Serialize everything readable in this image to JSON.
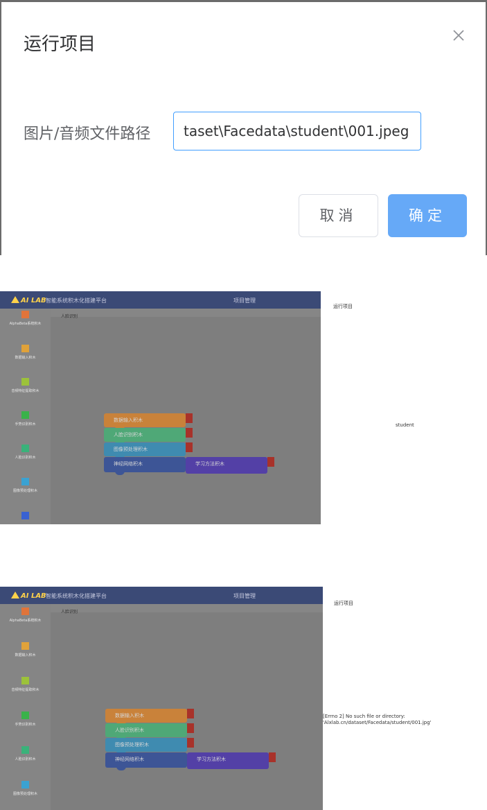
{
  "dialog": {
    "title": "运行项目",
    "close_icon": "close-icon",
    "field_label": "图片/音频文件路径",
    "path_value": "taset\\Facedata\\student\\001.jpeg",
    "cancel_label": "取消",
    "ok_label": "确定",
    "accent_color": "#409eff"
  },
  "app": {
    "brand": "AI LAB",
    "title": "智能系统积木化搭建平台",
    "menu_item": "项目管理",
    "tab": "人脸识别",
    "sidebar": [
      {
        "label": "AlphaBeta系统积木",
        "color": "#e0743a"
      },
      {
        "label": "数据输入积木",
        "color": "#e0a23a"
      },
      {
        "label": "音频特征提取积木",
        "color": "#9cc23a"
      },
      {
        "label": "手势识别积木",
        "color": "#3ab24a"
      },
      {
        "label": "人脸识别积木",
        "color": "#3ab27a"
      },
      {
        "label": "图像预处理积木",
        "color": "#3aa2d2"
      },
      {
        "label": "",
        "color": "#3a62d2"
      }
    ],
    "blocks": [
      {
        "label": "数据输入积木",
        "color": "#c9823a"
      },
      {
        "label": "人脸识别积木",
        "color": "#4fa877"
      },
      {
        "label": "图像预处理积木",
        "color": "#3f8bb0"
      },
      {
        "label": "神经网络积木",
        "color": "#3d5596"
      },
      {
        "label": "学习方法积木",
        "color": "#5340a6"
      }
    ]
  },
  "shot1": {
    "output_title": "运行项目",
    "output_text": "student"
  },
  "shot2": {
    "output_title": "运行项目",
    "output_line1": "[Errno 2] No such file or directory:",
    "output_line2": "'Alxlab.cn/dataset/Facedata/student/001.jpg'"
  }
}
